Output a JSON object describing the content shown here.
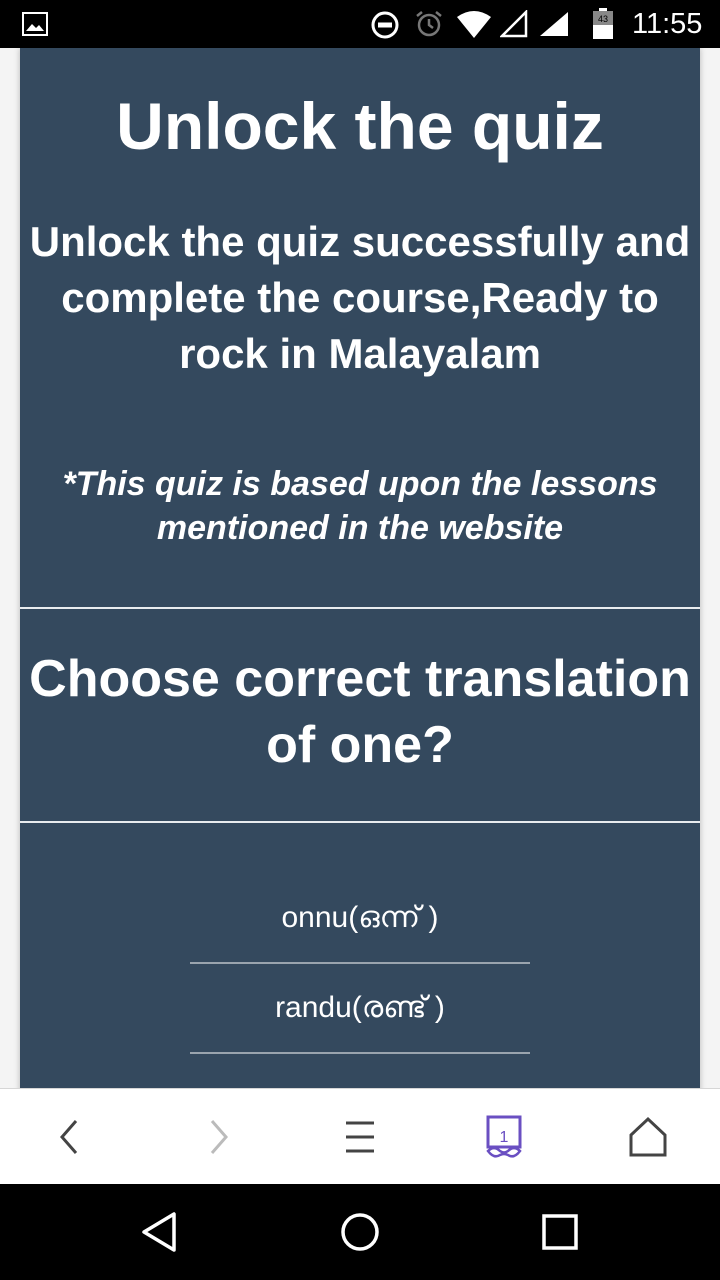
{
  "status_bar": {
    "time": "11:55",
    "icons": [
      "gallery-icon",
      "do-not-disturb-icon",
      "alarm-icon",
      "wifi-icon",
      "signal-icon",
      "signal-icon",
      "battery-icon"
    ],
    "battery_level": "43"
  },
  "quiz": {
    "title": "Unlock the quiz",
    "subtitle": "Unlock the quiz successfully and complete the course,Ready to rock in Malayalam",
    "note": "*This quiz is based upon the lessons mentioned in the website",
    "question": "Choose correct translation of one?",
    "options": [
      {
        "label": "onnu(ഒന്ന് )"
      },
      {
        "label": "randu(രണ്ട് )"
      }
    ]
  },
  "browser_bar": {
    "tab_count": "1",
    "icons": [
      "back-icon",
      "forward-icon",
      "menu-icon",
      "tabs-icon",
      "home-icon"
    ],
    "accent_color": "#6a4fc2"
  },
  "colors": {
    "card_bg": "#34495e",
    "text": "#ffffff"
  },
  "nav_bar": {
    "icons": [
      "nav-back-icon",
      "nav-home-icon",
      "nav-recents-icon"
    ]
  }
}
